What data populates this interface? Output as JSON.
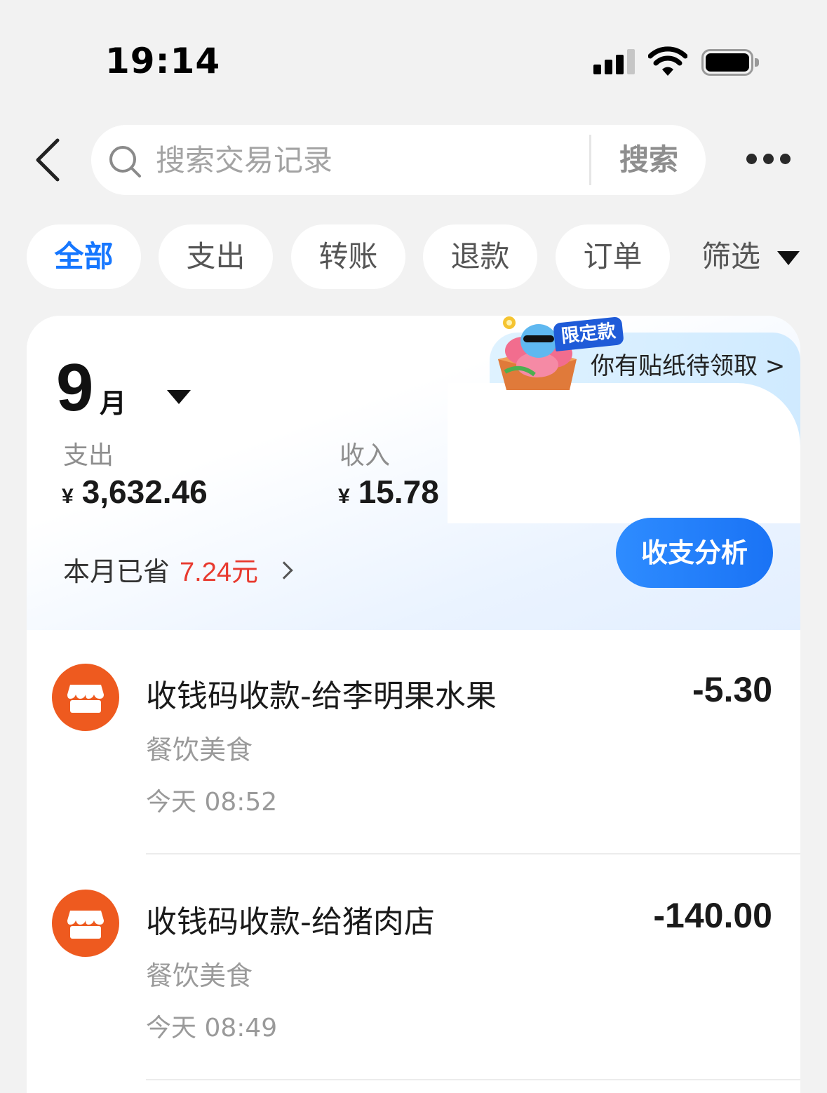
{
  "status_bar": {
    "time": "19:14"
  },
  "search": {
    "placeholder": "搜索交易记录",
    "button_label": "搜索"
  },
  "tabs": [
    {
      "label": "全部",
      "active": true
    },
    {
      "label": "支出",
      "active": false
    },
    {
      "label": "转账",
      "active": false
    },
    {
      "label": "退款",
      "active": false
    },
    {
      "label": "订单",
      "active": false
    }
  ],
  "filter": {
    "label": "筛选"
  },
  "banner": {
    "tag": "限定款",
    "text": "你有贴纸待领取 >"
  },
  "summary": {
    "month_number": "9",
    "month_unit": "月",
    "expense_label": "支出",
    "expense_value": "3,632.46",
    "income_label": "收入",
    "income_value": "15.78",
    "currency_symbol": "¥",
    "saved_label": "本月已省",
    "saved_amount": "7.24元",
    "analysis_button": "收支分析"
  },
  "transactions": [
    {
      "title": "收钱码收款-给李明果水果",
      "category": "餐饮美食",
      "time": "今天 08:52",
      "amount": "-5.30"
    },
    {
      "title": "收钱码收款-给猪肉店",
      "category": "餐饮美食",
      "time": "今天 08:49",
      "amount": "-140.00"
    }
  ],
  "colors": {
    "accent": "#1677ff",
    "saved_red": "#e83a2f",
    "merchant_icon": "#ee5a1f"
  }
}
